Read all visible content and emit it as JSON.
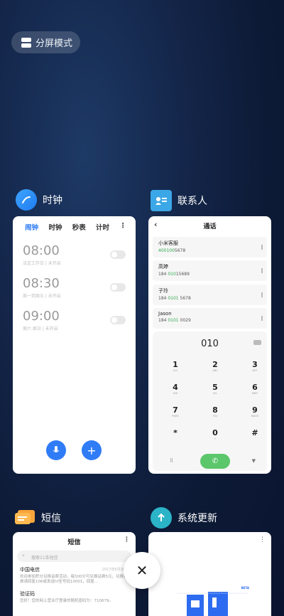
{
  "split_mode": {
    "label": "分屏模式"
  },
  "clock": {
    "app_name": "时钟",
    "tabs": [
      "闹钟",
      "时钟",
      "秒表",
      "计时"
    ],
    "alarms": [
      {
        "time": "08:00",
        "sub": "法定工作日 | 未开启"
      },
      {
        "time": "08:30",
        "sub": "周一到周五 | 未开启"
      },
      {
        "time": "09:00",
        "sub": "周六 周日 | 未开启"
      }
    ]
  },
  "contacts": {
    "app_name": "联系人",
    "screen_title": "通话",
    "entries": [
      {
        "name": "小米客服",
        "num_hl": "400100",
        "num_rest": "5678"
      },
      {
        "name": "高婷",
        "num_pre": "184 ",
        "num_hl": "010",
        "num_rest": "15689"
      },
      {
        "name": "子玲",
        "num_pre": "184 ",
        "num_hl": "0101",
        "num_rest": " 5678"
      },
      {
        "name": "Jason",
        "num_pre": "184 ",
        "num_hl": "0101",
        "num_rest": " 0029"
      }
    ],
    "dialed": "010",
    "keys": [
      {
        "d": "1",
        "l": "ILD"
      },
      {
        "d": "2",
        "l": "ABC"
      },
      {
        "d": "3",
        "l": "DEF"
      },
      {
        "d": "4",
        "l": "GHI"
      },
      {
        "d": "5",
        "l": "JKL"
      },
      {
        "d": "6",
        "l": "MNO"
      },
      {
        "d": "7",
        "l": "PQRS"
      },
      {
        "d": "8",
        "l": "TUV"
      },
      {
        "d": "9",
        "l": "WXYZ"
      },
      {
        "d": "*",
        "l": ""
      },
      {
        "d": "0",
        "l": "+"
      },
      {
        "d": "#",
        "l": ""
      }
    ]
  },
  "sms": {
    "app_name": "短信",
    "screen_title": "短信",
    "search_placeholder": "搜索11条短信",
    "items": [
      {
        "title": "中国电信",
        "preview": "欢迎参加积分兑换话费活动，每500分可兑换话费5元，兑换话费请回复106或发送hf至号码10001，回复...",
        "date": "2017年6月30日"
      },
      {
        "title": "验证码",
        "preview": "您好！您的网上营业厅登录的随机密码为：710679。"
      }
    ]
  },
  "system_update": {
    "app_name": "系统更新",
    "beta_label": "BETA"
  },
  "colors": {
    "accent": "#2f7cf6",
    "green": "#2fa84f",
    "call": "#5cc66a"
  }
}
